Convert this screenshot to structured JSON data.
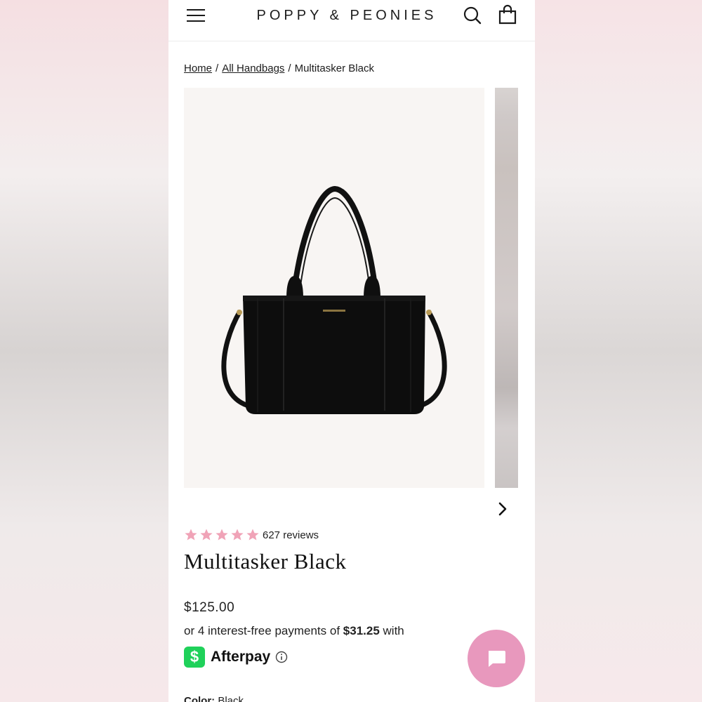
{
  "header": {
    "brand": "POPPY & PEONIES",
    "menu_icon": "hamburger-menu-icon",
    "search_icon": "search-icon",
    "bag_icon": "shopping-bag-icon"
  },
  "breadcrumb": {
    "items": [
      "Home",
      "All Handbags"
    ],
    "current": "Multitasker Black",
    "separator": "/"
  },
  "gallery": {
    "main_image": "black tote handbag product photo",
    "next_icon": "chevron-right-icon"
  },
  "product": {
    "rating": 5,
    "reviews_label": "627 reviews",
    "title": "Multitasker Black",
    "price": "$125.00",
    "installments_prefix": "or 4 interest-free payments of",
    "installments_amount": "$31.25",
    "installments_suffix": "with",
    "afterpay_name": "Afterpay",
    "afterpay_logo_glyph": "$",
    "color_label": "Color:",
    "color_value": "Black"
  },
  "colors": {
    "star": "#f0a3b7",
    "afterpay_green": "#1fd15a",
    "chat_button": "#e898bd"
  },
  "chat": {
    "icon": "chat-bubble-icon"
  }
}
